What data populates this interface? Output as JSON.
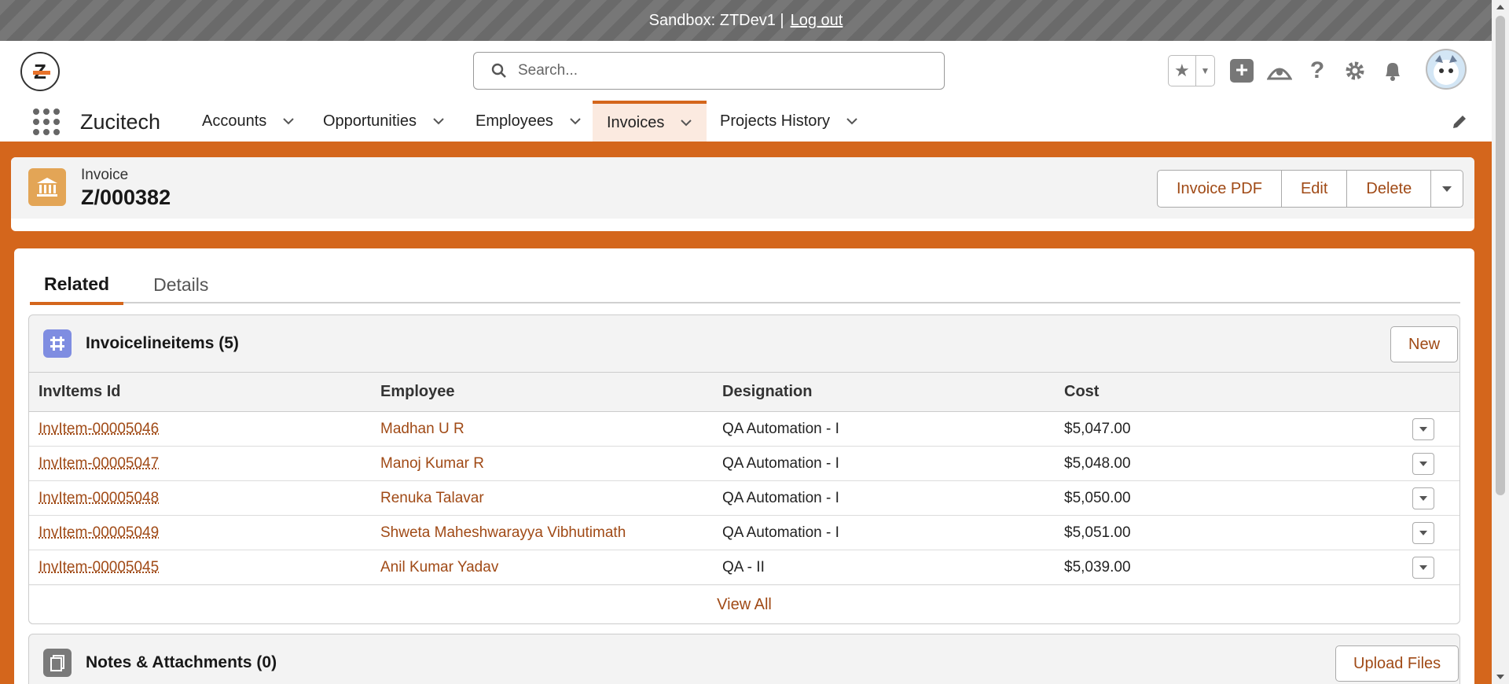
{
  "sandbox": {
    "text": "Sandbox: ZTDev1 |",
    "logout": "Log out"
  },
  "header": {
    "search_placeholder": "Search..."
  },
  "nav": {
    "app_name": "Zucitech",
    "items": [
      {
        "label": "Accounts"
      },
      {
        "label": "Opportunities"
      },
      {
        "label": "Employees"
      },
      {
        "label": "Invoices"
      },
      {
        "label": "Projects History"
      }
    ],
    "active": "Invoices"
  },
  "record": {
    "type": "Invoice",
    "title": "Z/000382",
    "buttons": {
      "pdf": "Invoice PDF",
      "edit": "Edit",
      "delete": "Delete"
    }
  },
  "tabs": {
    "related": "Related",
    "details": "Details",
    "active": "Related"
  },
  "invoice_items": {
    "title": "Invoicelineitems (5)",
    "new_label": "New",
    "columns": [
      "InvItems Id",
      "Employee",
      "Designation",
      "Cost"
    ],
    "rows": [
      {
        "id": "InvItem-00005046",
        "employee": "Madhan U R",
        "designation": "QA Automation - I",
        "cost": "$5,047.00"
      },
      {
        "id": "InvItem-00005047",
        "employee": "Manoj Kumar R",
        "designation": "QA Automation - I",
        "cost": "$5,048.00"
      },
      {
        "id": "InvItem-00005048",
        "employee": "Renuka Talavar",
        "designation": "QA Automation - I",
        "cost": "$5,050.00"
      },
      {
        "id": "InvItem-00005049",
        "employee": "Shweta Maheshwarayya Vibhutimath",
        "designation": "QA Automation - I",
        "cost": "$5,051.00"
      },
      {
        "id": "InvItem-00005045",
        "employee": "Anil Kumar Yadav",
        "designation": "QA - II",
        "cost": "$5,039.00"
      }
    ],
    "view_all": "View All"
  },
  "notes": {
    "title": "Notes & Attachments (0)",
    "upload_label": "Upload Files"
  },
  "colors": {
    "brand": "#d4661c",
    "link": "#a04a16",
    "record_icon": "#e3a556",
    "items_icon": "#7f8de1",
    "notes_icon": "#7a7a7a"
  }
}
